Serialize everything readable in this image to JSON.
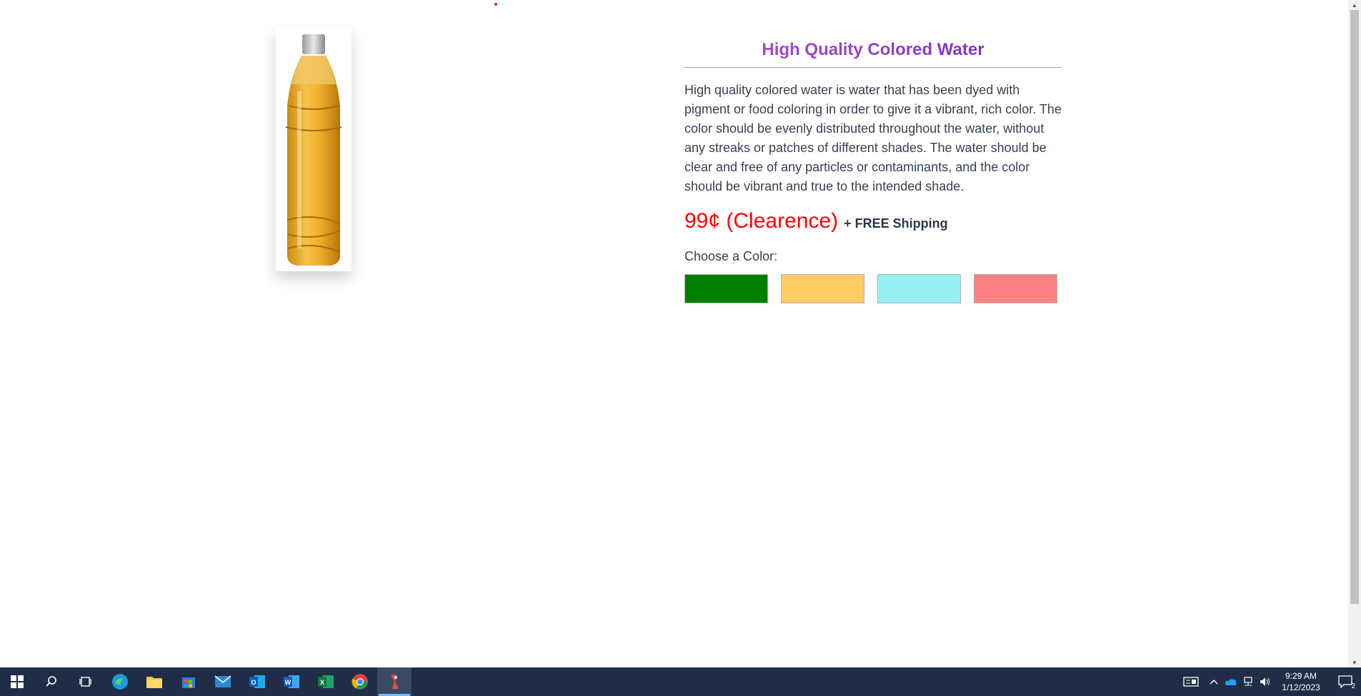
{
  "product": {
    "title": "High Quality Colored Water",
    "description": "High quality colored water is water that has been dyed with pigment or food coloring in order to give it a vibrant, rich color. The color should be evenly distributed throughout the water, without any streaks or patches of different shades. The water should be clear and free of any particles or contaminants, and the color should be vibrant and true to the intended shade.",
    "price": "99¢ (Clearence)",
    "shipping": "+ FREE Shipping",
    "color_label": "Choose a Color:",
    "image_icon": "bottle-image"
  },
  "colors": {
    "title_accent": "#8b3fb7",
    "price": "#ff0000",
    "swatches": [
      "#008000",
      "#ffcc66",
      "#99f0f0",
      "#ff8080"
    ]
  },
  "taskbar": {
    "apps": [
      "start-icon",
      "search-icon",
      "task-view-icon",
      "edge-icon",
      "file-explorer-icon",
      "store-icon",
      "mail-icon",
      "outlook-icon",
      "word-icon",
      "excel-icon",
      "chrome-icon",
      "app-icon"
    ],
    "time": "9:29 AM",
    "date": "1/12/2023",
    "notification_count": "2"
  }
}
